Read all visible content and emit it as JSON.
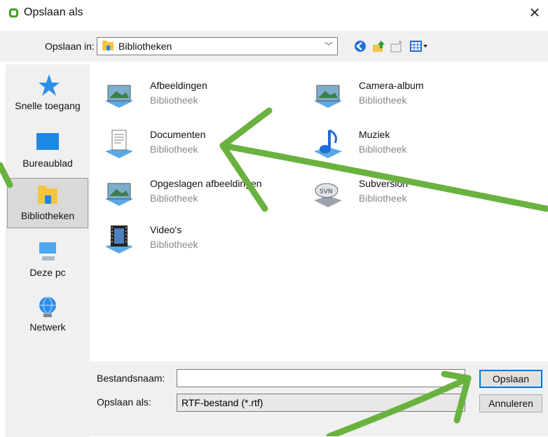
{
  "window": {
    "title": "Opslaan als"
  },
  "toolbar": {
    "save_in_label": "Opslaan in:",
    "location": "Bibliotheken"
  },
  "sidebar": {
    "items": [
      {
        "label": "Snelle toegang"
      },
      {
        "label": "Bureaublad"
      },
      {
        "label": "Bibliotheken",
        "selected": true
      },
      {
        "label": "Deze pc"
      },
      {
        "label": "Netwerk"
      }
    ]
  },
  "libraries": [
    {
      "name": "Afbeeldingen",
      "type": "Bibliotheek"
    },
    {
      "name": "Camera-album",
      "type": "Bibliotheek"
    },
    {
      "name": "Documenten",
      "type": "Bibliotheek"
    },
    {
      "name": "Muziek",
      "type": "Bibliotheek"
    },
    {
      "name": "Opgeslagen afbeeldingen",
      "type": "Bibliotheek"
    },
    {
      "name": "Subversion",
      "type": "Bibliotheek"
    },
    {
      "name": "Video's",
      "type": "Bibliotheek"
    }
  ],
  "form": {
    "filename_label": "Bestandsnaam:",
    "filename_value": "",
    "savetype_label": "Opslaan als:",
    "savetype_value": "RTF-bestand (*.rtf)",
    "save_button": "Opslaan",
    "cancel_button": "Annuleren"
  },
  "colors": {
    "accent": "#0078d7",
    "annotation_arrows": "#6ab23f"
  }
}
